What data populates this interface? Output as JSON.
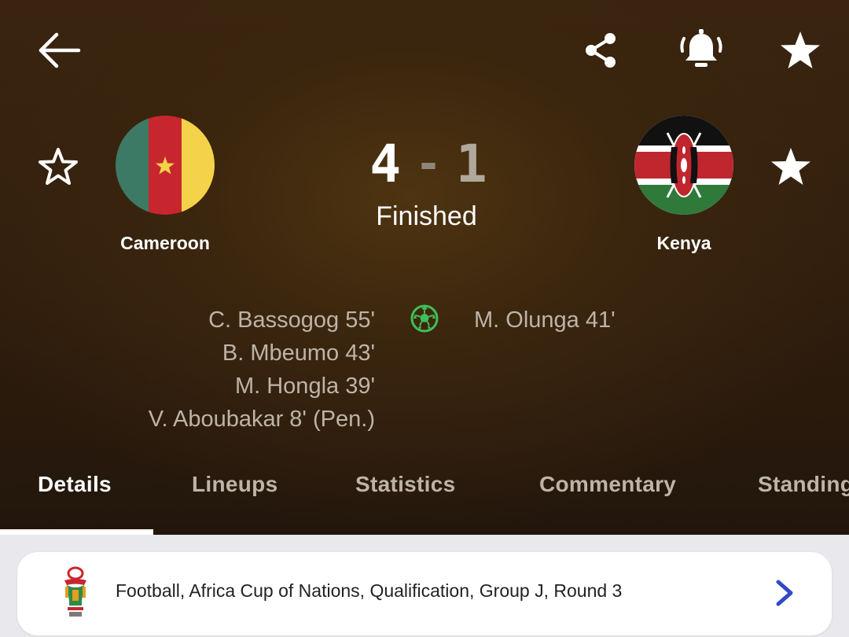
{
  "toolbar": {
    "back_icon": "arrow-left-icon",
    "share_icon": "share-icon",
    "notification_icon": "bell-ringing-icon",
    "favorite_icon": "star-filled-icon"
  },
  "match": {
    "home": {
      "name": "Cameroon",
      "flag": "cameroon-flag",
      "favorite_icon": "star-outline-icon"
    },
    "away": {
      "name": "Kenya",
      "flag": "kenya-flag",
      "favorite_icon": "star-filled-icon"
    },
    "score": {
      "home": "4",
      "separator": "-",
      "away": "1"
    },
    "status": "Finished"
  },
  "scorers": {
    "home": [
      "C. Bassogog 55'",
      "B. Mbeumo 43'",
      "M. Hongla 39'",
      "V. Aboubakar 8' (Pen.)"
    ],
    "away": [
      "M. Olunga 41'"
    ],
    "goal_icon": "soccer-ball-icon"
  },
  "tabs": [
    {
      "label": "Details",
      "active": true
    },
    {
      "label": "Lineups",
      "active": false
    },
    {
      "label": "Statistics",
      "active": false
    },
    {
      "label": "Commentary",
      "active": false
    },
    {
      "label": "Standings",
      "active": false
    }
  ],
  "competition": {
    "logo": "afcon-trophy-logo",
    "text": "Football, Africa Cup of Nations, Qualification, Group J, Round 3",
    "chevron_icon": "chevron-right-icon"
  },
  "colors": {
    "header_bg": "#3a250e",
    "text_primary": "#ffffff",
    "text_secondary": "#bdb4a8",
    "goal_green": "#3fbf5a",
    "chevron_blue": "#3349c9",
    "content_bg": "#e8e8ed"
  }
}
